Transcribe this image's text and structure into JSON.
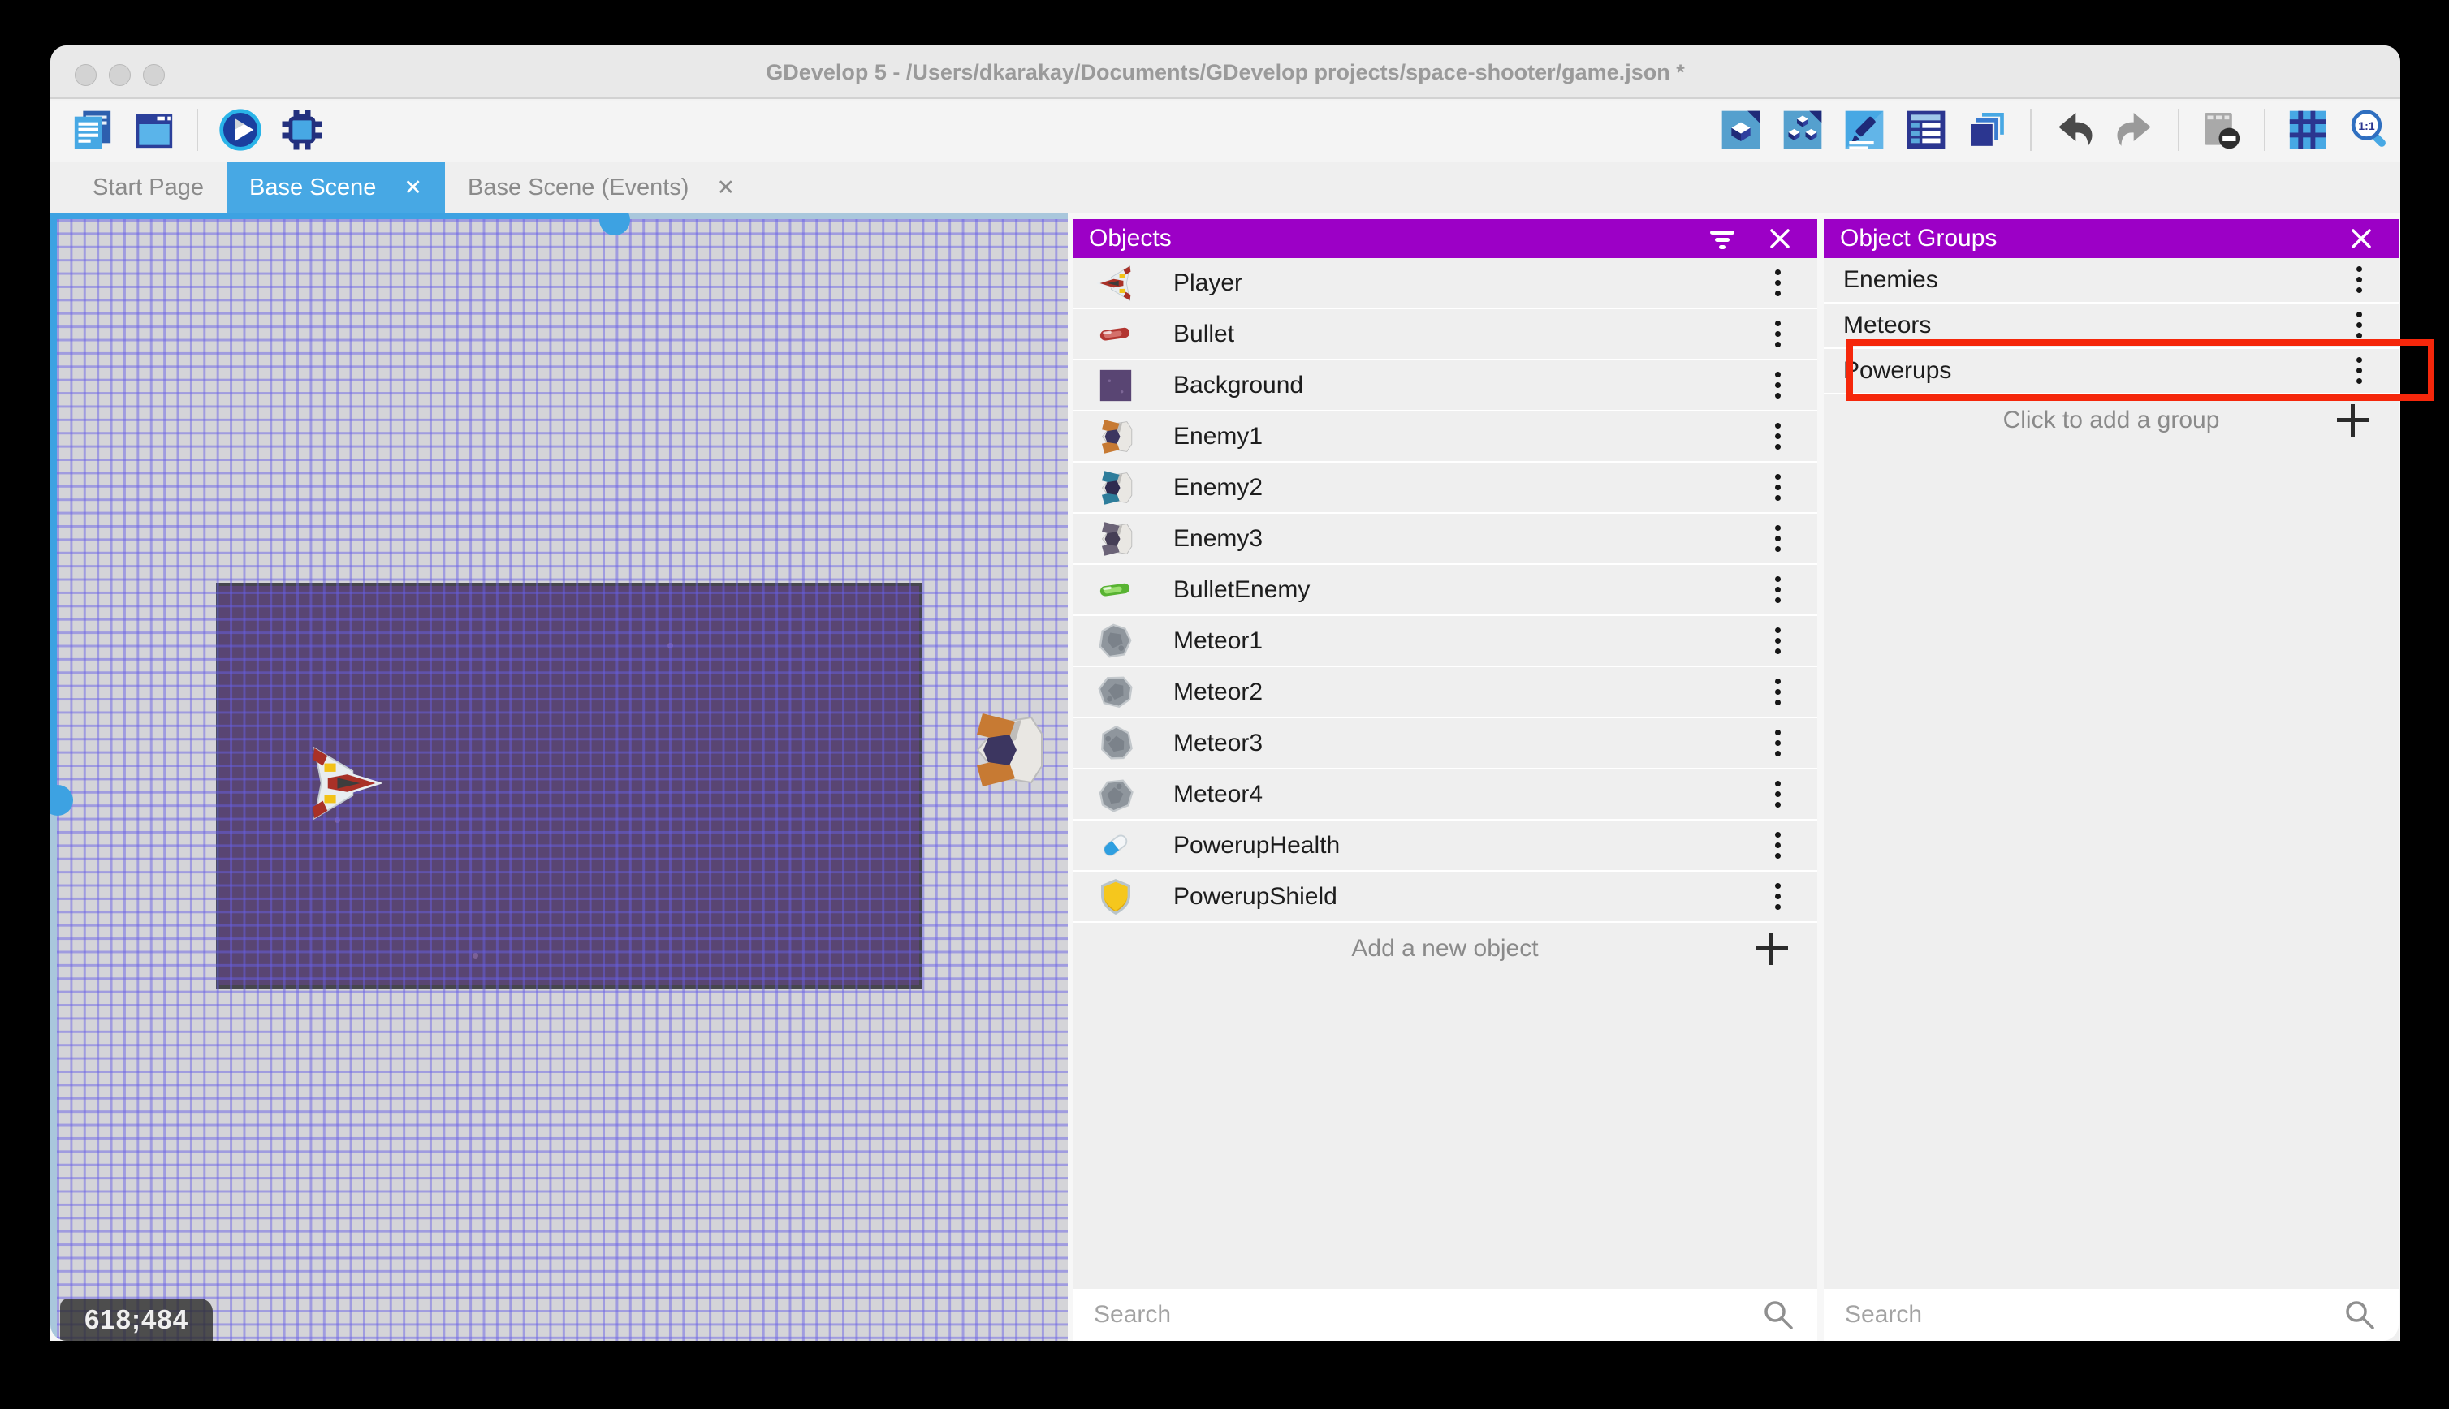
{
  "window": {
    "title": "GDevelop 5 - /Users/dkarakay/Documents/GDevelop projects/space-shooter/game.json *",
    "coordinates_badge": "618;484",
    "traffic_lights": [
      "close",
      "minimize",
      "maximize"
    ]
  },
  "toolbar": {
    "left": [
      {
        "name": "project-manager-icon"
      },
      {
        "name": "scene-window-icon"
      },
      {
        "name": "separator"
      },
      {
        "name": "play-icon"
      },
      {
        "name": "debug-icon"
      }
    ],
    "right": [
      {
        "name": "object-editor-icon"
      },
      {
        "name": "object-groups-editor-icon"
      },
      {
        "name": "properties-icon"
      },
      {
        "name": "instances-list-icon"
      },
      {
        "name": "layers-icon"
      },
      {
        "name": "separator"
      },
      {
        "name": "undo-icon"
      },
      {
        "name": "redo-icon"
      },
      {
        "name": "separator"
      },
      {
        "name": "mask-icon"
      },
      {
        "name": "separator"
      },
      {
        "name": "grid-icon"
      },
      {
        "name": "zoom-1-1-icon"
      }
    ]
  },
  "tabs": [
    {
      "label": "Start Page",
      "active": false,
      "closable": false
    },
    {
      "label": "Base Scene",
      "active": true,
      "closable": true
    },
    {
      "label": "Base Scene (Events)",
      "active": false,
      "closable": true
    }
  ],
  "canvas": {
    "instances": [
      {
        "name": "player-instance",
        "sprite": "player-ship"
      },
      {
        "name": "enemy1-instance",
        "sprite": "enemy1-ship"
      }
    ]
  },
  "objects_panel": {
    "title": "Objects",
    "items": [
      {
        "label": "Player",
        "icon": "player"
      },
      {
        "label": "Bullet",
        "icon": "bullet"
      },
      {
        "label": "Background",
        "icon": "background"
      },
      {
        "label": "Enemy1",
        "icon": "enemy1"
      },
      {
        "label": "Enemy2",
        "icon": "enemy2"
      },
      {
        "label": "Enemy3",
        "icon": "enemy3"
      },
      {
        "label": "BulletEnemy",
        "icon": "bullet-enemy"
      },
      {
        "label": "Meteor1",
        "icon": "meteor1"
      },
      {
        "label": "Meteor2",
        "icon": "meteor2"
      },
      {
        "label": "Meteor3",
        "icon": "meteor3"
      },
      {
        "label": "Meteor4",
        "icon": "meteor4"
      },
      {
        "label": "PowerupHealth",
        "icon": "powerup-health"
      },
      {
        "label": "PowerupShield",
        "icon": "powerup-shield"
      }
    ],
    "add_label": "Add a new object",
    "search_placeholder": "Search"
  },
  "object_groups_panel": {
    "title": "Object Groups",
    "items": [
      {
        "label": "Enemies",
        "highlighted": false
      },
      {
        "label": "Meteors",
        "highlighted": false
      },
      {
        "label": "Powerups",
        "highlighted": true
      }
    ],
    "add_label": "Click to add a group",
    "search_placeholder": "Search"
  },
  "colors": {
    "accent_blue": "#47a8e4",
    "panel_header_purple": "#9c00c6",
    "highlight_red": "#f5270b",
    "scene_background_purple": "#594573",
    "grid_line": "#675fe6"
  }
}
